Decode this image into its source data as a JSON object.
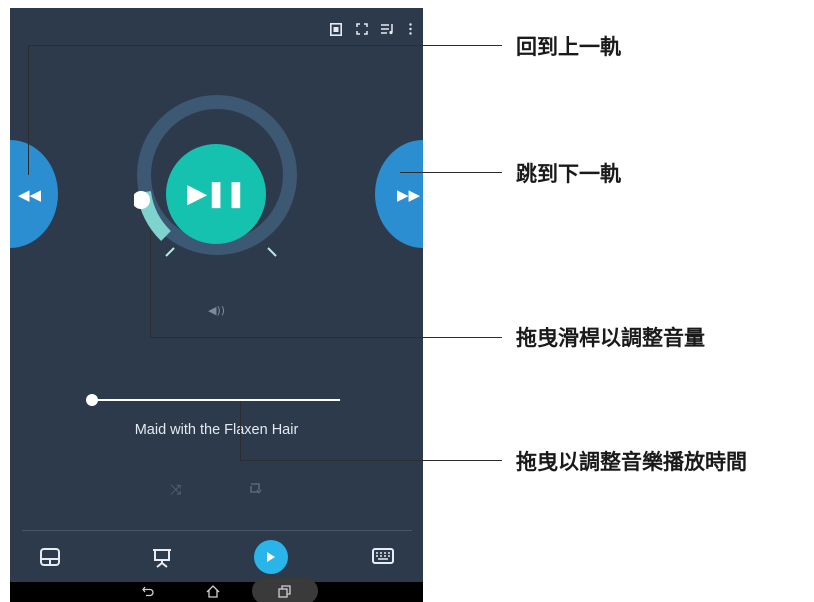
{
  "player": {
    "track_title": "Maid with the Flaxen Hair",
    "play_pause_glyph": "▶❚❚",
    "prev_glyph": "◀◀",
    "next_glyph": "▶▶",
    "volume_glyph": "◀))",
    "shuffle_glyph": "⤨",
    "seek_progress": 0.0,
    "volume_level": 0.17
  },
  "toolbar": {
    "icons": [
      "screen-mirror-icon",
      "fullscreen-icon",
      "playlist-icon",
      "more-vert-icon"
    ]
  },
  "dock": {
    "icons": [
      "touchpad-icon",
      "presentation-icon",
      "play-icon",
      "keyboard-icon"
    ]
  },
  "nav": {
    "icons": [
      "back-icon",
      "home-icon",
      "recent-apps-icon"
    ]
  },
  "annotations": {
    "prev_track": "回到上一軌",
    "next_track": "跳到下一軌",
    "volume": "拖曳滑桿以調整音量",
    "seek": "拖曳以調整音樂播放時間"
  },
  "colors": {
    "background": "#2d3a4b",
    "accent_teal": "#15c2b0",
    "side_button_blue": "#2a8ed0",
    "dock_play_blue": "#29b4ea"
  }
}
